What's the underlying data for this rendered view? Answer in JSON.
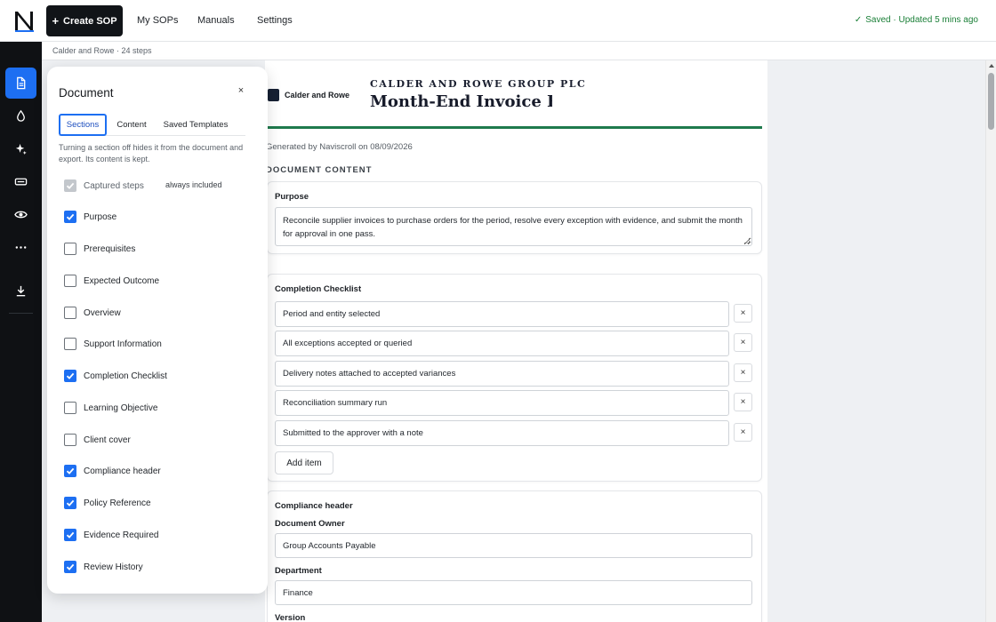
{
  "topbar": {
    "create_label": "Create SOP",
    "create_icon": "plus-icon",
    "nav": [
      "My SOPs",
      "Manuals",
      "Settings"
    ],
    "status": "Saved · Updated 5 mins ago",
    "status_icon": "check-icon",
    "status_color": "#1a7f37"
  },
  "rail": {
    "items": [
      "document-icon",
      "droplet-icon",
      "sparkle-icon",
      "badge-icon",
      "eye-icon",
      "more-icon",
      "download-icon"
    ],
    "active_color": "#1d6ff2"
  },
  "breadcrumb": "Calder and Rowe · 24 steps",
  "document": {
    "brand_name": "Calder and Rowe",
    "company": "CALDER AND ROWE GROUP PLC",
    "title": "Month-End Invoice Reconciliation",
    "generated": "Generated by Naviscroll on 08/09/2026",
    "content_heading": "DOCUMENT CONTENT",
    "rule_color": "#1f7a4d",
    "purpose": {
      "label": "Purpose",
      "text": "Reconcile supplier invoices to purchase orders for the period, resolve every exception with evidence, and submit the month for approval in one pass."
    },
    "checklist": {
      "label": "Completion Checklist",
      "items": [
        "Period and entity selected",
        "All exceptions accepted or queried",
        "Delivery notes attached to accepted variances",
        "Reconciliation summary run",
        "Submitted to the approver with a note"
      ],
      "remove_glyph": "×",
      "add_label": "Add item"
    },
    "compliance": {
      "label": "Compliance header",
      "owner_label": "Document Owner",
      "owner_value": "Group Accounts Payable",
      "department_label": "Department",
      "department_value": "Finance",
      "version_label": "Version"
    }
  },
  "panel": {
    "title": "Document",
    "close_glyph": "×",
    "tabs": [
      "Sections",
      "Content",
      "Saved Templates"
    ],
    "active_tab": "Sections",
    "help": "Turning a section off hides it from the document and export. Its content is kept.",
    "options": [
      {
        "label": "Captured steps",
        "checked": true,
        "disabled": true,
        "note": "always included"
      },
      {
        "label": "Purpose",
        "checked": true
      },
      {
        "label": "Prerequisites",
        "checked": false
      },
      {
        "label": "Expected Outcome",
        "checked": false
      },
      {
        "label": "Overview",
        "checked": false
      },
      {
        "label": "Support Information",
        "checked": false
      },
      {
        "label": "Completion Checklist",
        "checked": true
      },
      {
        "label": "Learning Objective",
        "checked": false
      },
      {
        "label": "Client cover",
        "checked": false
      },
      {
        "label": "Compliance header",
        "checked": true
      },
      {
        "label": "Policy Reference",
        "checked": true
      },
      {
        "label": "Evidence Required",
        "checked": true
      },
      {
        "label": "Review History",
        "checked": true
      }
    ]
  }
}
